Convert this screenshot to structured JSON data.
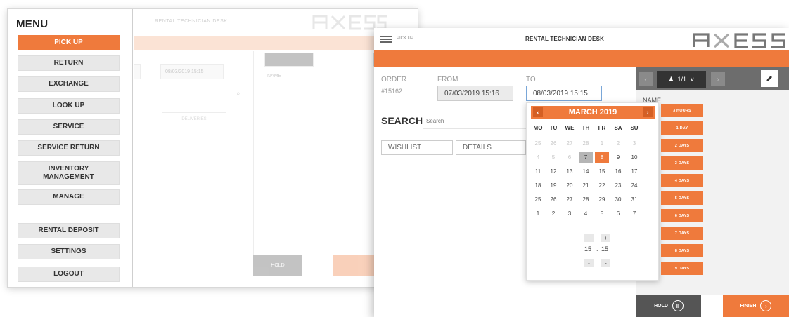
{
  "menu": {
    "title": "MENU",
    "items": [
      {
        "label": "PICK UP",
        "active": true
      },
      {
        "label": "RETURN",
        "active": false
      },
      {
        "label": "EXCHANGE",
        "active": false
      },
      {
        "label": "LOOK UP",
        "active": false
      },
      {
        "label": "SERVICE",
        "active": false
      },
      {
        "label": "SERVICE RETURN",
        "active": false
      },
      {
        "label": "INVENTORY MANAGEMENT",
        "active": false
      },
      {
        "label": "MANAGE",
        "active": false
      },
      {
        "label": "RENTAL DEPOSIT",
        "active": false
      },
      {
        "label": "SETTINGS",
        "active": false
      },
      {
        "label": "LOGOUT",
        "active": false
      }
    ]
  },
  "back_window": {
    "title": "RENTAL TECHNICIAN DESK",
    "to_value": "08/03/2019 15:15",
    "deliveries_label": "DELIVERIES",
    "name_label": "NAME",
    "hold_label": "HOLD"
  },
  "header": {
    "breadcrumb": "PICK UP",
    "title": "RENTAL TECHNICIAN DESK",
    "brand": "AXESS",
    "accent": "#ef7a3c"
  },
  "order": {
    "order_label": "ORDER",
    "order_number": "#15162",
    "from_label": "FROM",
    "from_value": "07/03/2019 15:16",
    "to_label": "TO",
    "to_value": "08/03/2019 15:15"
  },
  "search": {
    "label": "SEARCH",
    "placeholder": "Search"
  },
  "tabs": {
    "wishlist": "WISHLIST",
    "details": "DETAILS"
  },
  "right_panel": {
    "pager": "1/1",
    "name_label": "NAME"
  },
  "actions": {
    "hold": "HOLD",
    "finish": "FINISH"
  },
  "calendar": {
    "month_label": "MARCH 2019",
    "weekdays": [
      "MO",
      "TU",
      "WE",
      "TH",
      "FR",
      "SA",
      "SU"
    ],
    "weeks": [
      [
        {
          "d": "25",
          "o": true
        },
        {
          "d": "26",
          "o": true
        },
        {
          "d": "27",
          "o": true
        },
        {
          "d": "28",
          "o": true
        },
        {
          "d": "1",
          "o": true
        },
        {
          "d": "2",
          "o": true
        },
        {
          "d": "3",
          "o": true
        }
      ],
      [
        {
          "d": "4",
          "o": true
        },
        {
          "d": "5",
          "o": true
        },
        {
          "d": "6",
          "o": true
        },
        {
          "d": "7",
          "s": "gray"
        },
        {
          "d": "8",
          "s": "orange"
        },
        {
          "d": "9"
        },
        {
          "d": "10"
        }
      ],
      [
        {
          "d": "11"
        },
        {
          "d": "12"
        },
        {
          "d": "13"
        },
        {
          "d": "14"
        },
        {
          "d": "15"
        },
        {
          "d": "16"
        },
        {
          "d": "17"
        }
      ],
      [
        {
          "d": "18"
        },
        {
          "d": "19"
        },
        {
          "d": "20"
        },
        {
          "d": "21"
        },
        {
          "d": "22"
        },
        {
          "d": "23"
        },
        {
          "d": "24"
        }
      ],
      [
        {
          "d": "25"
        },
        {
          "d": "26"
        },
        {
          "d": "27"
        },
        {
          "d": "28"
        },
        {
          "d": "29"
        },
        {
          "d": "30"
        },
        {
          "d": "31"
        }
      ],
      [
        {
          "d": "1"
        },
        {
          "d": "2"
        },
        {
          "d": "3"
        },
        {
          "d": "4"
        },
        {
          "d": "5"
        },
        {
          "d": "6"
        },
        {
          "d": "7"
        }
      ]
    ],
    "time_hour": "15",
    "time_minute": "15",
    "time_separator": ":"
  },
  "presets": [
    "3 HOURS",
    "1 DAY",
    "2 DAYS",
    "3 DAYS",
    "4 DAYS",
    "5 DAYS",
    "6 DAYS",
    "7 DAYS",
    "8 DAYS",
    "9 DAYS"
  ]
}
